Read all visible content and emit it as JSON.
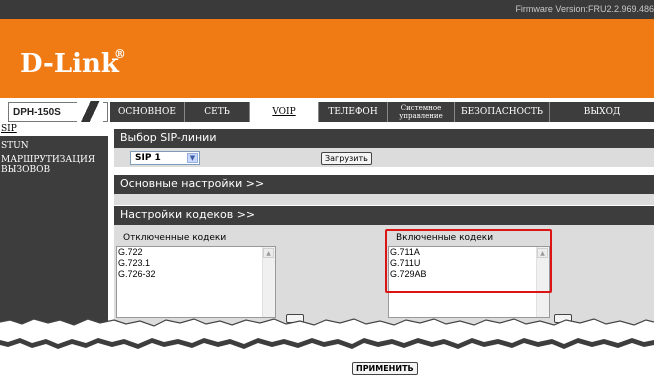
{
  "header": {
    "firmware": "Firmware Version:FRU2.2.969.486"
  },
  "brand": {
    "logo": "D-Link",
    "logo_mark": "®"
  },
  "device": {
    "model": "DPH-150S"
  },
  "nav": {
    "tabs": [
      {
        "label": "ОСНОВНОЕ"
      },
      {
        "label": "СЕТЬ"
      },
      {
        "label": "VOIP"
      },
      {
        "label": "ТЕЛЕФОН"
      },
      {
        "label": "Системное управление"
      },
      {
        "label": "БЕЗОПАСНОСТЬ"
      },
      {
        "label": "ВЫХОД"
      }
    ]
  },
  "sidebar": {
    "items": [
      {
        "label": "SIP"
      },
      {
        "label": "STUN"
      },
      {
        "label": "МАРШРУТИЗАЦИЯ ВЫЗОВОВ"
      }
    ]
  },
  "sip_line": {
    "title": "Выбор SIP-линии",
    "selected": "SIP 1",
    "load_button": "Загрузить"
  },
  "basic": {
    "title": "Основные настройки >>"
  },
  "codecs": {
    "title": "Настройки кодеков >>",
    "disabled_label": "Отключенные кодеки",
    "enabled_label": "Включенные кодеки",
    "disabled_list": [
      "G.722",
      "G.723.1",
      "G.726-32"
    ],
    "enabled_list": [
      "G.711A",
      "G.711U",
      "G.729AB"
    ]
  },
  "footer": {
    "apply_button": "ПРИМЕНИТЬ"
  },
  "colors": {
    "brand_orange": "#f07a14",
    "dark_bar": "#3d3d3d",
    "highlight_red": "#dc1414"
  }
}
